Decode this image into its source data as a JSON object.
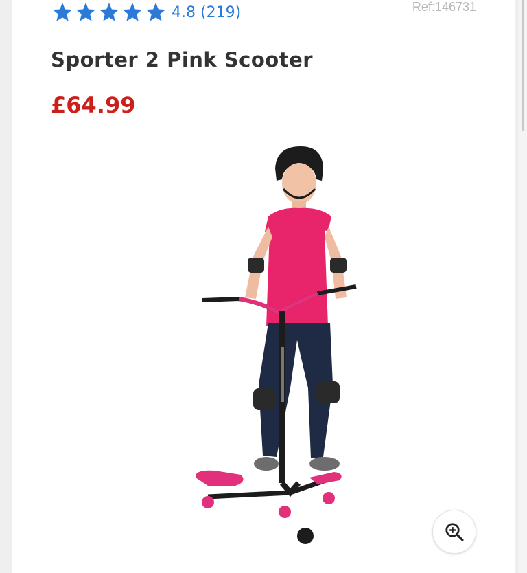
{
  "product": {
    "rating": {
      "value": "4.8",
      "count_text": "(219)",
      "stars": 5,
      "star_color": "#2b7ad8"
    },
    "reference": "Ref:146731",
    "title": "Sporter 2 Pink Scooter",
    "price": "£64.99",
    "price_color": "#cc1f1a",
    "image_icon": "product-photo-girl-on-pink-scooter",
    "zoom_icon": "zoom-in-icon"
  }
}
